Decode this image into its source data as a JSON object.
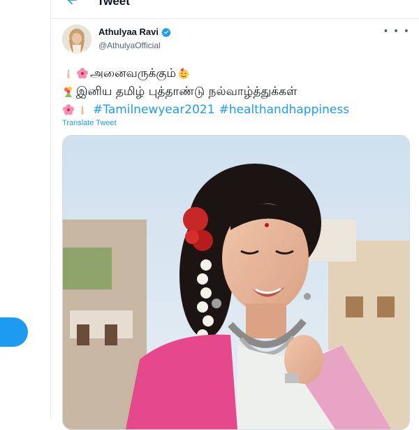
{
  "header": {
    "title": "Tweet"
  },
  "tweet": {
    "display_name": "Athulyaa Ravi",
    "handle": "@AthulyaOfficial",
    "line1": "அனைவருக்கும்",
    "line2": "இனிய தமிழ் புத்தாண்டு நல்வாழ்த்துக்கள்",
    "hashtag1": "#Tamilnewyear2021",
    "hashtag2": "#healthandhappiness",
    "translate_label": "Translate Tweet"
  },
  "icons": {
    "back": "back-arrow-icon",
    "verified": "verified-badge-icon",
    "more": "more-options-icon"
  },
  "colors": {
    "accent": "#1d9bf0",
    "text": "#0f1419",
    "muted": "#536471"
  }
}
